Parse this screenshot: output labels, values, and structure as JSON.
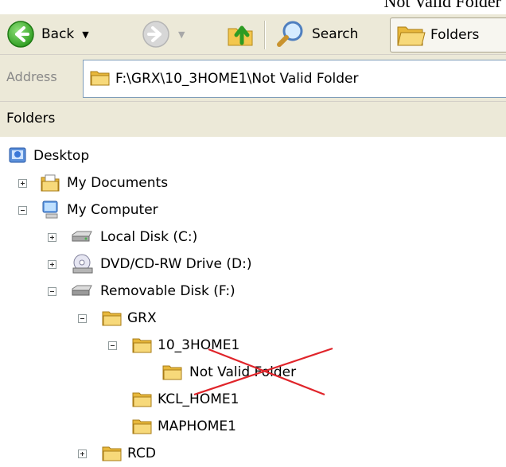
{
  "caption_text": "Not Valid Folder",
  "toolbar": {
    "back_label": "Back",
    "search_label": "Search",
    "folders_label": "Folders"
  },
  "address": {
    "label": "Address",
    "value": "F:\\GRX\\10_3HOME1\\Not Valid Folder"
  },
  "pane": {
    "title": "Folders"
  },
  "tree": {
    "desktop": "Desktop",
    "my_documents": "My Documents",
    "my_computer": "My Computer",
    "local_disk": "Local Disk (C:)",
    "dvd_drive": "DVD/CD-RW Drive (D:)",
    "removable_disk": "Removable Disk (F:)",
    "grx": "GRX",
    "home1": "10_3HOME1",
    "not_valid": "Not Valid Folder",
    "kcl_home": "KCL_HOME1",
    "map_home": "MAPHOME1",
    "rcd": "RCD"
  },
  "colors": {
    "crossout": "#e0242a",
    "folder": "#f5d36a",
    "toolbar_bg": "#ece9d8"
  }
}
